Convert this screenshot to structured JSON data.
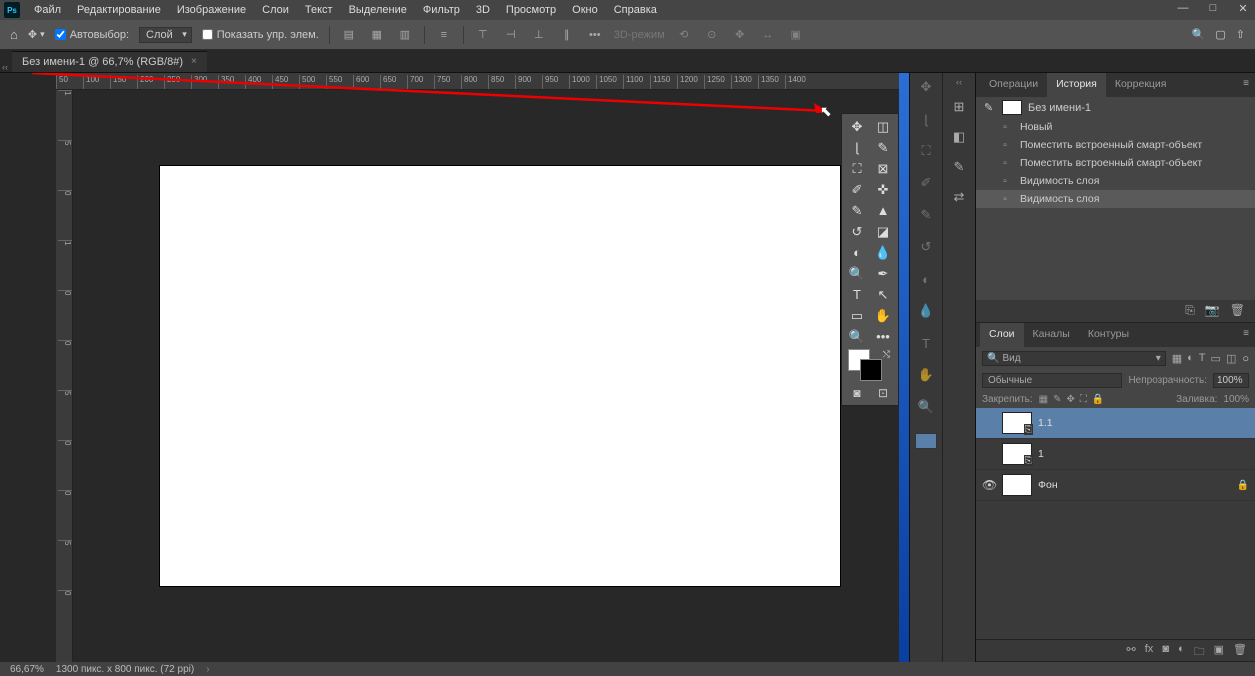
{
  "menu": {
    "items": [
      "Файл",
      "Редактирование",
      "Изображение",
      "Слои",
      "Текст",
      "Выделение",
      "Фильтр",
      "3D",
      "Просмотр",
      "Окно",
      "Справка"
    ],
    "logo": "Ps"
  },
  "options": {
    "autoselect": "Автовыбор:",
    "layer_dd": "Слой",
    "show_controls": "Показать упр. элем.",
    "mode3d": "3D-режим"
  },
  "document": {
    "tab_title": "Без имени-1 @ 66,7% (RGB/8#)"
  },
  "ruler": {
    "marks": [
      "50",
      "100",
      "150",
      "200",
      "250",
      "300",
      "350",
      "400",
      "450",
      "500",
      "550",
      "600",
      "650",
      "700",
      "750",
      "800",
      "850",
      "900",
      "950",
      "1000",
      "1050",
      "1100",
      "1150",
      "1200",
      "1250",
      "1300",
      "1350",
      "1400"
    ],
    "vmarks": [
      "1",
      "5",
      "0",
      "1",
      "0",
      "0",
      "5",
      "0",
      "0",
      "5",
      "0"
    ]
  },
  "history": {
    "tabs": {
      "ops": "Операции",
      "hist": "История",
      "corr": "Коррекция"
    },
    "doc": "Без имени-1",
    "items": [
      "Новый",
      "Поместить встроенный смарт-объект",
      "Поместить встроенный смарт-объект",
      "Видимость слоя",
      "Видимость слоя"
    ]
  },
  "layers": {
    "tabs": {
      "layers": "Слои",
      "channels": "Каналы",
      "paths": "Контуры"
    },
    "search": "Вид",
    "blend_mode": "Обычные",
    "opacity_label": "Непрозрачность:",
    "opacity_val": "100%",
    "lock_label": "Закрепить:",
    "fill_label": "Заливка:",
    "fill_val": "100%",
    "items": [
      {
        "name": "1.1",
        "smart": true,
        "visible": false,
        "selected": true
      },
      {
        "name": "1",
        "smart": true,
        "visible": false,
        "selected": false
      },
      {
        "name": "Фон",
        "smart": false,
        "visible": true,
        "selected": false,
        "locked": true
      }
    ]
  },
  "status": {
    "zoom": "66,67%",
    "dims": "1300 пикс. x 800 пикс. (72 ppi)"
  }
}
